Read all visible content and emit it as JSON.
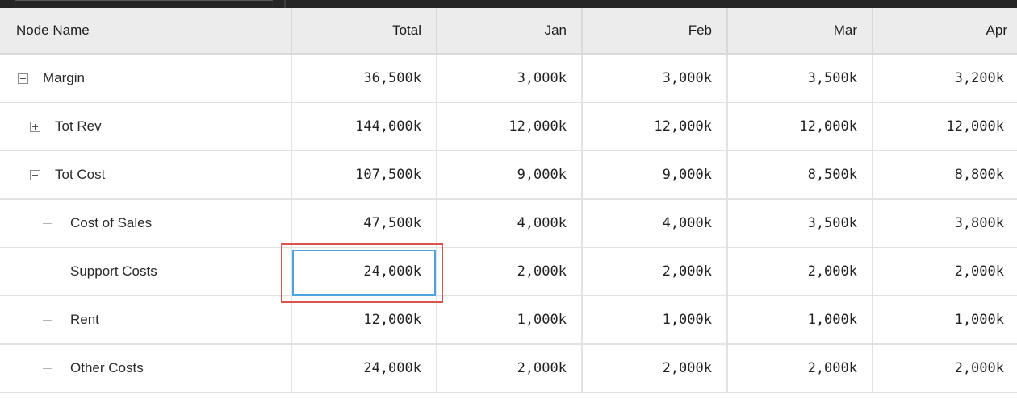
{
  "header": {
    "node_name": "Node Name",
    "total": "Total",
    "jan": "Jan",
    "feb": "Feb",
    "mar": "Mar",
    "apr": "Apr"
  },
  "rows": [
    {
      "name": "Margin",
      "toggle": "minus",
      "level": 0,
      "total": "36,500k",
      "jan": "3,000k",
      "feb": "3,000k",
      "mar": "3,500k",
      "apr": "3,200k"
    },
    {
      "name": "Tot Rev",
      "toggle": "plus",
      "level": 1,
      "total": "144,000k",
      "jan": "12,000k",
      "feb": "12,000k",
      "mar": "12,000k",
      "apr": "12,000k"
    },
    {
      "name": "Tot Cost",
      "toggle": "minus",
      "level": 1,
      "total": "107,500k",
      "jan": "9,000k",
      "feb": "9,000k",
      "mar": "8,500k",
      "apr": "8,800k"
    },
    {
      "name": "Cost of Sales",
      "toggle": "leaf",
      "level": 2,
      "total": "47,500k",
      "jan": "4,000k",
      "feb": "4,000k",
      "mar": "3,500k",
      "apr": "3,800k"
    },
    {
      "name": "Support Costs",
      "toggle": "leaf",
      "level": 2,
      "total": "24,000k",
      "jan": "2,000k",
      "feb": "2,000k",
      "mar": "2,000k",
      "apr": "2,000k"
    },
    {
      "name": "Rent",
      "toggle": "leaf",
      "level": 2,
      "total": "12,000k",
      "jan": "1,000k",
      "feb": "1,000k",
      "mar": "1,000k",
      "apr": "1,000k"
    },
    {
      "name": "Other Costs",
      "toggle": "leaf",
      "level": 2,
      "total": "24,000k",
      "jan": "2,000k",
      "feb": "2,000k",
      "mar": "2,000k",
      "apr": "2,000k"
    }
  ],
  "selection": {
    "row": "Support Costs",
    "column": "Total"
  },
  "colors": {
    "selection_outer": "#d9534f",
    "selection_inner": "#4da3e0",
    "header_bg": "#ececec",
    "topbar": "#252526"
  }
}
